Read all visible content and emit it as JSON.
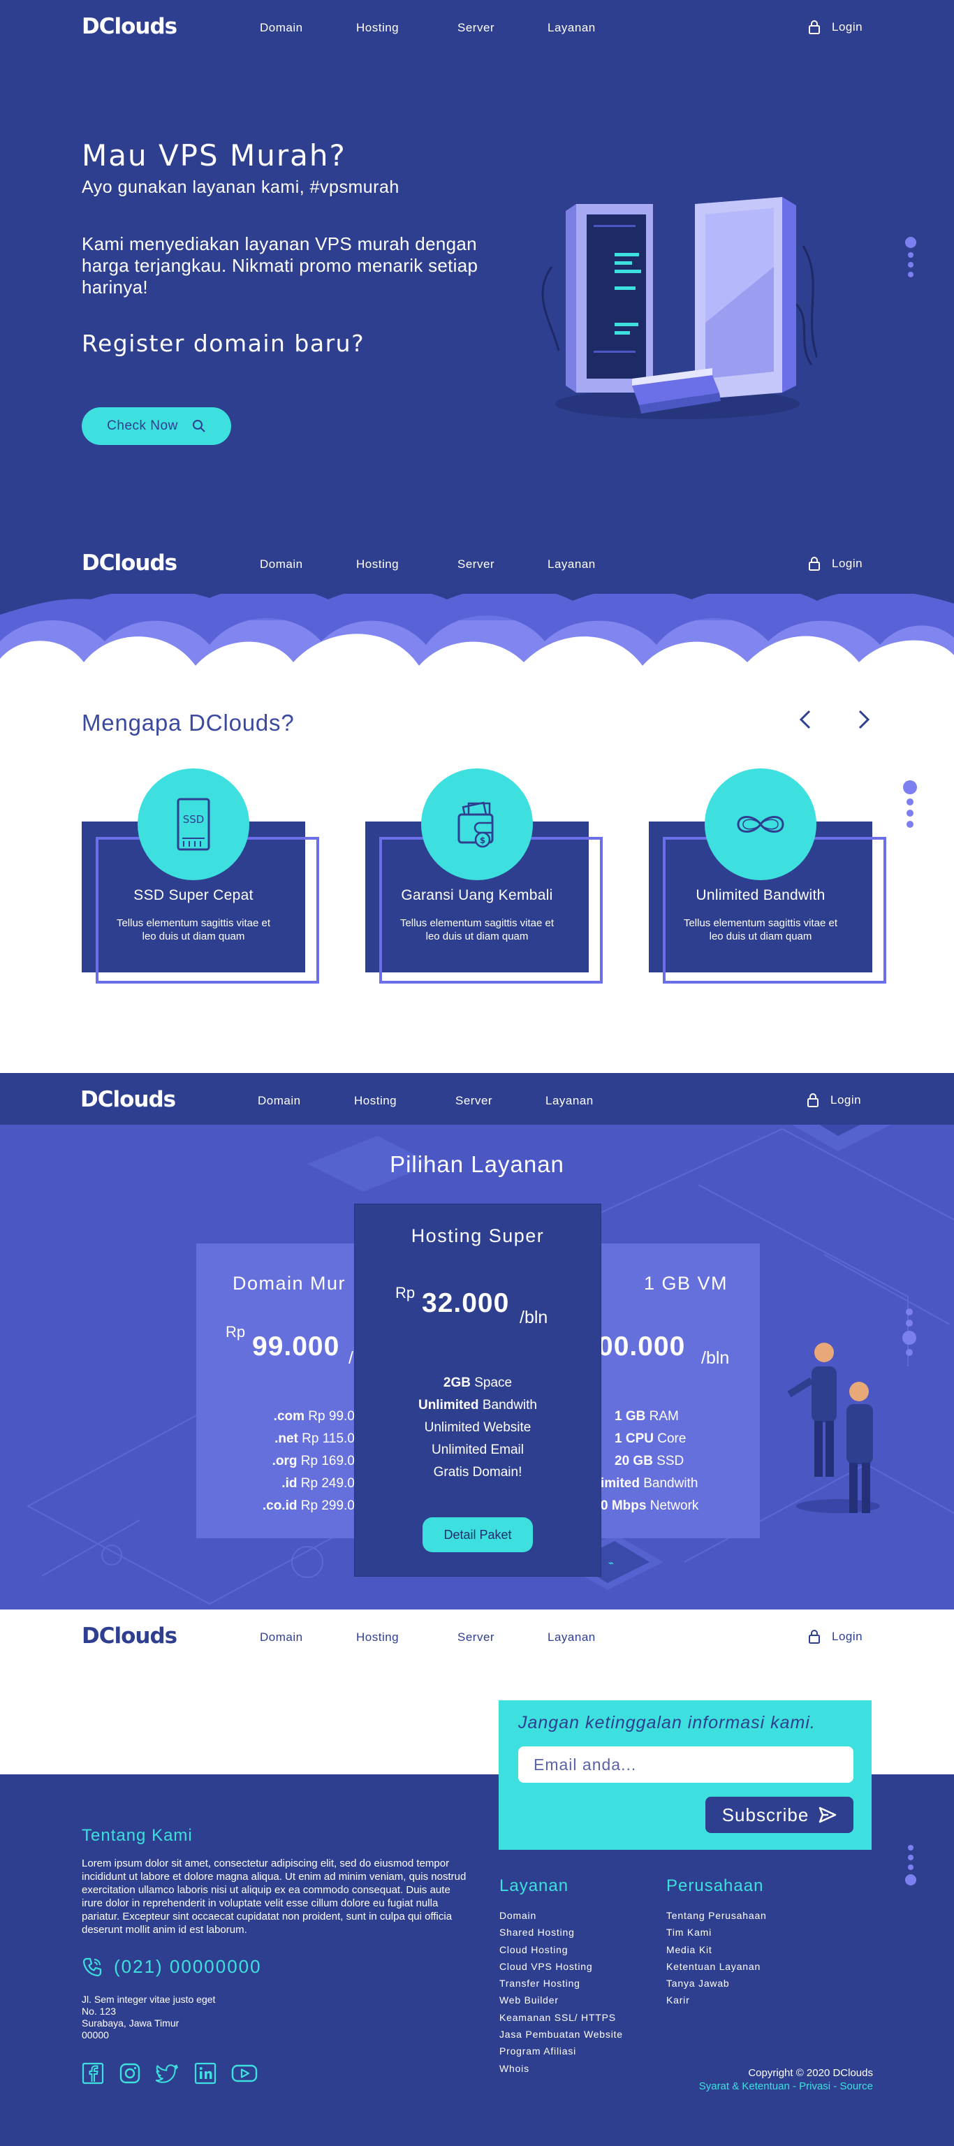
{
  "nav": {
    "logo": "DClouds",
    "links": [
      "Domain",
      "Hosting",
      "Server",
      "Layanan"
    ],
    "login": "Login"
  },
  "hero": {
    "title": "Mau VPS Murah?",
    "subtitle": "Ayo gunakan layanan kami, #vpsmurah",
    "description": "Kami menyediakan layanan VPS murah dengan harga terjangkau. Nikmati promo menarik setiap harinya!",
    "heading2": "Register domain baru?",
    "cta": "Check Now"
  },
  "why": {
    "title": "Mengapa DClouds?",
    "features": [
      {
        "title": "SSD Super Cepat",
        "desc": "Tellus elementum sagittis vitae et leo duis ut diam quam",
        "icon": "ssd-icon"
      },
      {
        "title": "Garansi Uang Kembali",
        "desc": "Tellus elementum sagittis vitae et leo duis ut diam quam",
        "icon": "wallet-icon"
      },
      {
        "title": "Unlimited Bandwith",
        "desc": "Tellus elementum sagittis vitae et leo duis ut diam quam",
        "icon": "infinity-icon"
      }
    ]
  },
  "services": {
    "title": "Pilihan Layanan",
    "domain": {
      "title": "Domain Mur",
      "rp": "Rp",
      "amount": "99.000",
      "per": "/",
      "items": [
        {
          "b": ".com",
          "t": " Rp 99.000"
        },
        {
          "b": ".net",
          "t": " Rp 115.000"
        },
        {
          "b": ".org",
          "t": " Rp 169.000"
        },
        {
          "b": ".id",
          "t": " Rp 249.000"
        },
        {
          "b": ".co.id",
          "t": " Rp 299.000"
        }
      ]
    },
    "hosting": {
      "title": "Hosting Super",
      "rp": "Rp",
      "amount": "32.000",
      "per": "/bln",
      "items": [
        {
          "b": "2GB",
          "t": " Space"
        },
        {
          "b": "Unlimited",
          "t": " Bandwith"
        },
        {
          "b": "",
          "t": "Unlimited Website"
        },
        {
          "b": "",
          "t": "Unlimited Email"
        },
        {
          "b": "",
          "t": "Gratis Domain!"
        }
      ],
      "button": "Detail Paket"
    },
    "vm": {
      "title": "1 GB VM",
      "amount": "00.000",
      "per": "/bln",
      "items": [
        {
          "b": "1 GB",
          "t": " RAM"
        },
        {
          "b": "1 CPU",
          "t": " Core"
        },
        {
          "b": "20 GB",
          "t": " SSD"
        },
        {
          "b": "imited",
          "t": " Bandwith"
        },
        {
          "b": "0 Mbps",
          "t": " Network"
        }
      ]
    }
  },
  "footer": {
    "newsletter": {
      "title": "Jangan ketinggalan informasi kami.",
      "placeholder": "Email anda...",
      "button": "Subscribe"
    },
    "about_title": "Tentang Kami",
    "about_text": "Lorem ipsum dolor sit amet, consectetur adipiscing elit, sed do eiusmod tempor incididunt ut labore et dolore magna aliqua. Ut enim ad minim veniam, quis nostrud exercitation ullamco laboris nisi ut aliquip ex ea commodo consequat. Duis aute irure dolor in reprehenderit in voluptate velit esse cillum dolore eu fugiat nulla pariatur. Excepteur sint occaecat cupidatat non proident, sunt in culpa qui officia deserunt mollit anim id est laborum.",
    "phone": "(021) 00000000",
    "address": [
      "Jl. Sem integer vitae justo eget",
      "No. 123",
      "Surabaya, Jawa Timur",
      "00000"
    ],
    "layanan_title": "Layanan",
    "layanan": [
      "Domain",
      "Shared Hosting",
      "Cloud Hosting",
      "Cloud VPS Hosting",
      "Transfer Hosting",
      "Web Builder",
      "Keamanan SSL/ HTTPS",
      "Jasa Pembuatan Website",
      "Program Afiliasi",
      "Whois"
    ],
    "perusahaan_title": "Perusahaan",
    "perusahaan": [
      "Tentang Perusahaan",
      "Tim Kami",
      "Media Kit",
      "Ketentuan Layanan",
      "Tanya Jawab",
      "Karir"
    ],
    "copyright": "Copyright © 2020 DClouds",
    "legal_links": "Syarat & Ketentuan - Privasi - Source"
  },
  "colors": {
    "navy": "#2f3f8f",
    "cyan": "#3de0de",
    "violet": "#6670dc"
  }
}
